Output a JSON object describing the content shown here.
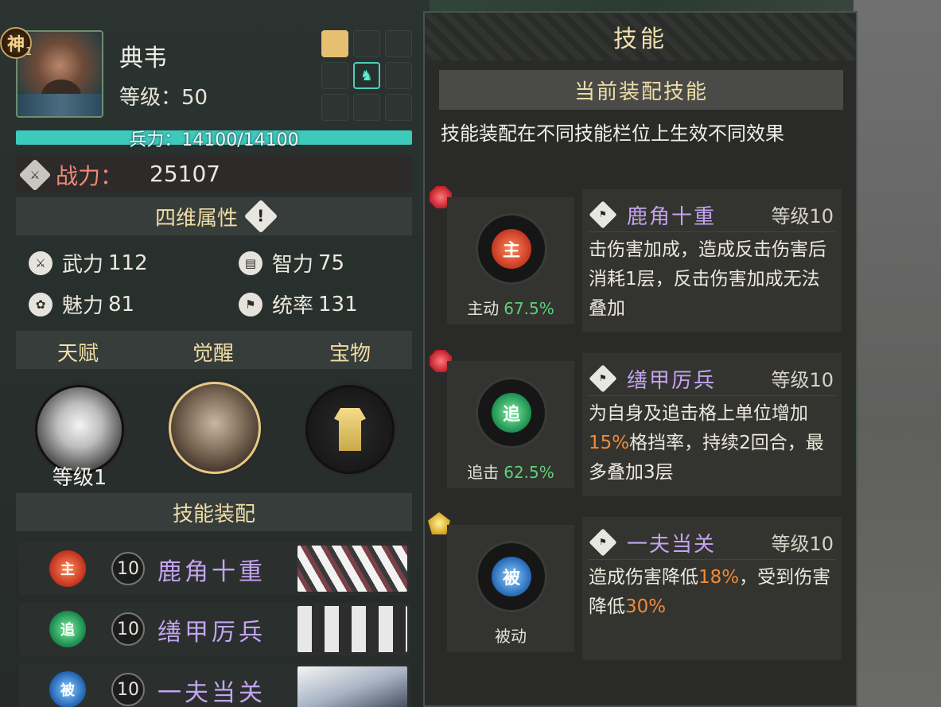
{
  "hero": {
    "name": "典韦",
    "rank_badge": "神",
    "rank_num": "1",
    "level_text": "等级：50",
    "hp_text": "兵力：14100/14100",
    "power_label": "战力：",
    "power_value": "25107"
  },
  "attributes": {
    "section_title": "四维属性",
    "items": [
      {
        "label": "武力",
        "value": "112",
        "icon": "sword-icon"
      },
      {
        "label": "智力",
        "value": "75",
        "icon": "book-icon"
      },
      {
        "label": "魅力",
        "value": "81",
        "icon": "flower-icon"
      },
      {
        "label": "统率",
        "value": "131",
        "icon": "flag-icon"
      }
    ]
  },
  "tabs": {
    "talent": "天赋",
    "awaken": "觉醒",
    "treasure": "宝物",
    "talent_level": "等级1"
  },
  "skill_loadout": {
    "title": "技能装配",
    "rows": [
      {
        "type_char": "主",
        "level": "10",
        "name": "鹿角十重",
        "color": "#e0583c"
      },
      {
        "type_char": "追",
        "level": "10",
        "name": "缮甲厉兵",
        "color": "#2fbf6a"
      },
      {
        "type_char": "被",
        "level": "10",
        "name": "一夫当关",
        "color": "#3a8fe0"
      }
    ]
  },
  "right_panel": {
    "title": "技能",
    "subtitle": "当前装配技能",
    "note": "技能装配在不同技能栏位上生效不同效果",
    "cards": [
      {
        "type_char": "主",
        "caption": "主动",
        "percent": "67.5%",
        "name": "鹿角十重",
        "level": "等级10",
        "desc_parts": [
          "击伤害加成，造成反击伤害后消耗1层，反击伤害加成无法叠加"
        ],
        "color": "#e0583c",
        "gem": "red"
      },
      {
        "type_char": "追",
        "caption": "追击",
        "percent": "62.5%",
        "name": "缮甲厉兵",
        "level": "等级10",
        "desc_a": "为自身及追击格上单位增加",
        "desc_hl1": "15%",
        "desc_b": "格挡率，持续2回合，最多叠加3层",
        "color": "#2fbf6a",
        "gem": "red"
      },
      {
        "type_char": "被",
        "caption": "被动",
        "percent": "",
        "name": "一夫当关",
        "level": "等级10",
        "desc_a": "造成伤害降低",
        "desc_hl1": "18%",
        "desc_b": "，受到伤害降低",
        "desc_hl2": "30%",
        "color": "#3a8fe0",
        "gem": "gold"
      }
    ]
  },
  "colors": {
    "accent_gold": "#f0dda6",
    "skill_purple": "#c4a4f0",
    "hp_teal": "#3ec9bd",
    "highlight_orange": "#f08a3a",
    "percent_green": "#5dd07a"
  }
}
